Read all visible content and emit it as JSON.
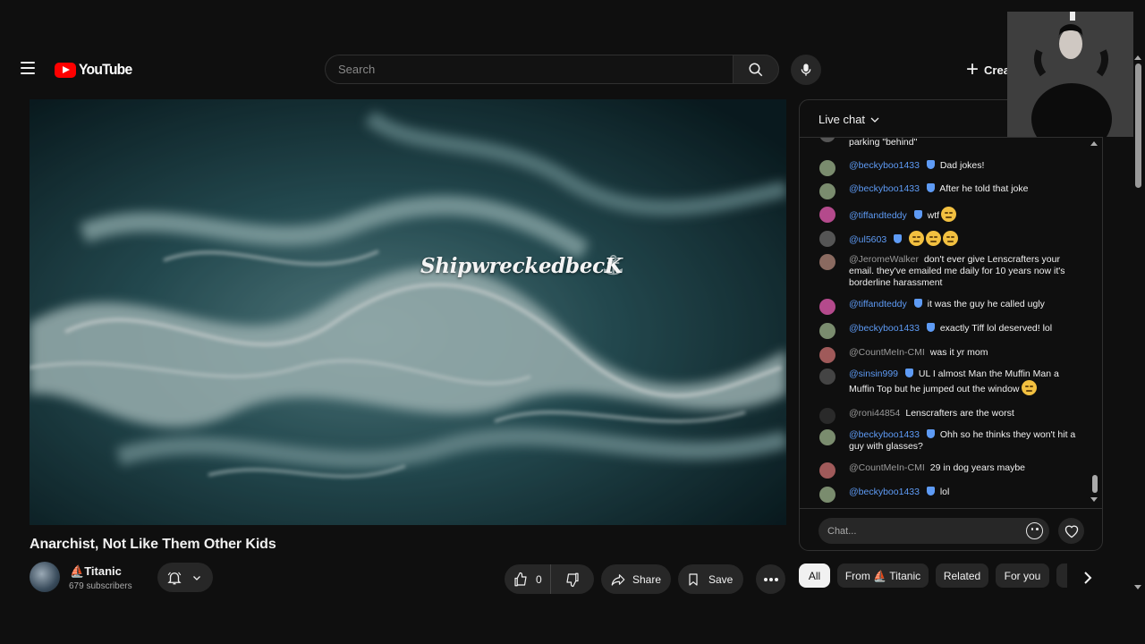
{
  "header": {
    "logo_text": "YouTube",
    "search_placeholder": "Search",
    "create_label": "Create"
  },
  "player": {
    "watermark": "ShipwreckedbecK"
  },
  "video": {
    "title": "Anarchist, Not Like Them Other Kids",
    "channel_name": "Titanic",
    "subscribers": "679 subscribers",
    "like_count": "0",
    "share_label": "Share",
    "save_label": "Save"
  },
  "chat": {
    "title": "Live chat",
    "input_placeholder": "Chat...",
    "partial_message": "parking \"behind\"",
    "messages": [
      {
        "author": "@beckyboo1433",
        "mod": true,
        "text": "Dad jokes!",
        "emojis": 0,
        "avatar_color": "#7a8c6e"
      },
      {
        "author": "@beckyboo1433",
        "mod": true,
        "text": "After he told that joke",
        "emojis": 0,
        "avatar_color": "#7a8c6e"
      },
      {
        "author": "@tiffandteddy",
        "mod": true,
        "text": "wtf",
        "emojis": 1,
        "avatar_color": "#b44a8c"
      },
      {
        "author": "@ul5603",
        "mod": true,
        "text": "",
        "emojis": 3,
        "avatar_color": "#555555"
      },
      {
        "author": "@JeromeWalker",
        "mod": false,
        "text": "don't ever give Lenscrafters your email. they've emailed me daily for 10 years now it's borderline harassment",
        "emojis": 0,
        "avatar_color": "#8a6a60"
      },
      {
        "author": "@tiffandteddy",
        "mod": true,
        "text": "it was the guy he called ugly",
        "emojis": 0,
        "avatar_color": "#b44a8c"
      },
      {
        "author": "@beckyboo1433",
        "mod": true,
        "text": "exactly Tiff lol deserved! lol",
        "emojis": 0,
        "avatar_color": "#7a8c6e"
      },
      {
        "author": "@CountMeIn-CMI",
        "mod": false,
        "text": "was it yr mom",
        "emojis": 0,
        "avatar_color": "#a05a5a"
      },
      {
        "author": "@sinsin999",
        "mod": true,
        "text": "UL I almost Man the Muffin Man a Muffin Top but he jumped out the window",
        "emojis": 1,
        "avatar_color": "#444444"
      },
      {
        "author": "@roni44854",
        "mod": false,
        "text": "Lenscrafters are the worst",
        "emojis": 0,
        "avatar_color": "#2a2a2a"
      },
      {
        "author": "@beckyboo1433",
        "mod": true,
        "text": "Ohh so he thinks they won't hit a guy with glasses?",
        "emojis": 0,
        "avatar_color": "#7a8c6e"
      },
      {
        "author": "@CountMeIn-CMI",
        "mod": false,
        "text": "29 in dog years maybe",
        "emojis": 0,
        "avatar_color": "#a05a5a"
      },
      {
        "author": "@beckyboo1433",
        "mod": true,
        "text": "lol",
        "emojis": 0,
        "avatar_color": "#7a8c6e"
      }
    ]
  },
  "chips": {
    "all": "All",
    "from_channel": "From ⛵ Titanic",
    "related": "Related",
    "for_you": "For you"
  },
  "icons": {
    "menu": "menu-icon",
    "search": "search-icon",
    "mic": "mic-icon",
    "create": "plus-icon",
    "bell": "bell-icon",
    "like": "thumbs-up-icon",
    "dislike": "thumbs-down-icon",
    "share": "share-icon",
    "save": "bookmark-icon",
    "more": "more-horizontal-icon",
    "emoji": "emoji-icon",
    "heart": "heart-icon"
  },
  "colors": {
    "brand_red": "#ff0000",
    "mod_blue": "#5e9bf5",
    "background": "#0f0f0f"
  }
}
